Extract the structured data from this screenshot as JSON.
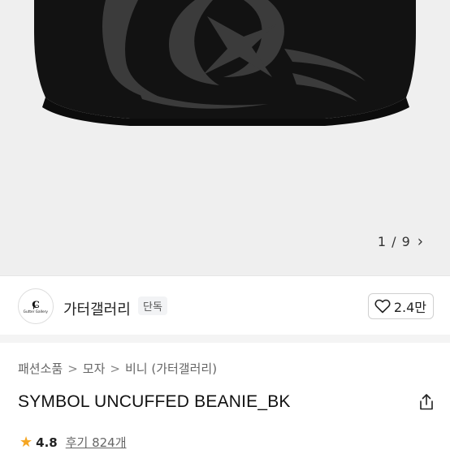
{
  "image_pager": {
    "counter": "1 / 9",
    "next_icon": "chevron-right-icon"
  },
  "store": {
    "logo_text": "Gutter Gallery",
    "name": "가터갤러리",
    "badge": "단독",
    "like_count": "2.4만",
    "like_icon": "heart-outline-icon"
  },
  "breadcrumb": {
    "items": [
      "패션소품",
      "모자",
      "비니 (가터갤러리)"
    ],
    "separator": ">"
  },
  "product": {
    "title": "SYMBOL UNCUFFED BEANIE_BK",
    "share_icon": "share-icon"
  },
  "rating": {
    "score": "4.8",
    "reviews": "후기 824개",
    "star_color": "#f5a623"
  },
  "colors": {
    "hero_bg": "#efefef",
    "beanie": "#111111",
    "beanie_pattern": "#3a3a3a"
  }
}
